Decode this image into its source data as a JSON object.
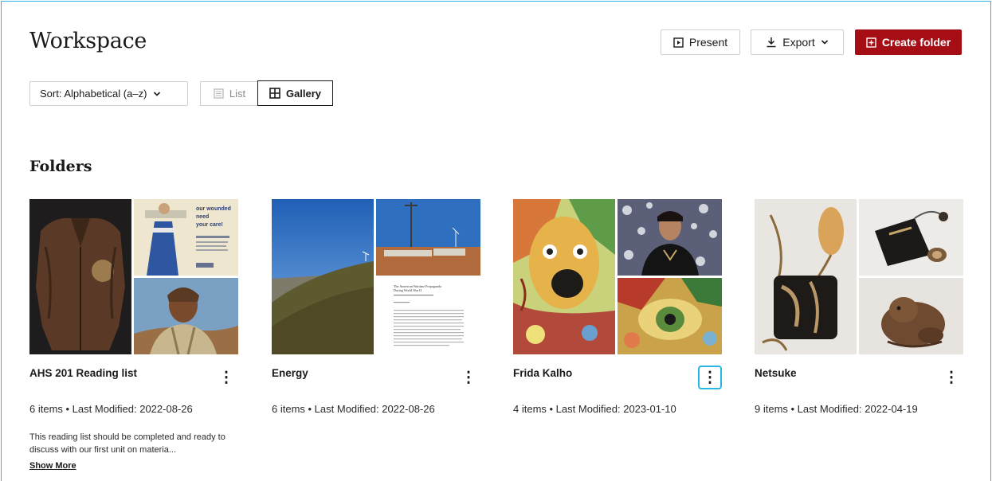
{
  "header": {
    "title": "Workspace",
    "present_label": "Present",
    "export_label": "Export",
    "create_folder_label": "Create folder"
  },
  "toolbar": {
    "sort_label": "Sort: Alphabetical (a–z)",
    "view_list_label": "List",
    "view_gallery_label": "Gallery",
    "active_view": "Gallery"
  },
  "section": {
    "title": "Folders"
  },
  "folders": [
    {
      "name": "AHS 201 Reading list",
      "meta": "6 items • Last Modified: 2022-08-26",
      "description": "This reading list should be completed and ready to discuss with our first unit on materia...",
      "show_more": "Show More",
      "poster_text": "our wounded need your care!"
    },
    {
      "name": "Energy",
      "meta": "6 items • Last Modified: 2022-08-26",
      "doc_title": "The American Wartime Propaganda During World War II"
    },
    {
      "name": "Frida Kalho",
      "meta": "4 items • Last Modified: 2023-01-10"
    },
    {
      "name": "Netsuke",
      "meta": "9 items • Last Modified: 2022-04-19"
    }
  ],
  "colors": {
    "accent_red": "#a50e14",
    "focus_blue": "#29b6e3",
    "border_gray": "#cfcfcf"
  },
  "icons": {
    "present": "present-icon",
    "export": "download-icon",
    "create": "folder-plus-icon",
    "sort": "chevron-down-icon",
    "list": "list-icon",
    "gallery": "grid-icon",
    "menu": "kebab-menu-icon"
  }
}
